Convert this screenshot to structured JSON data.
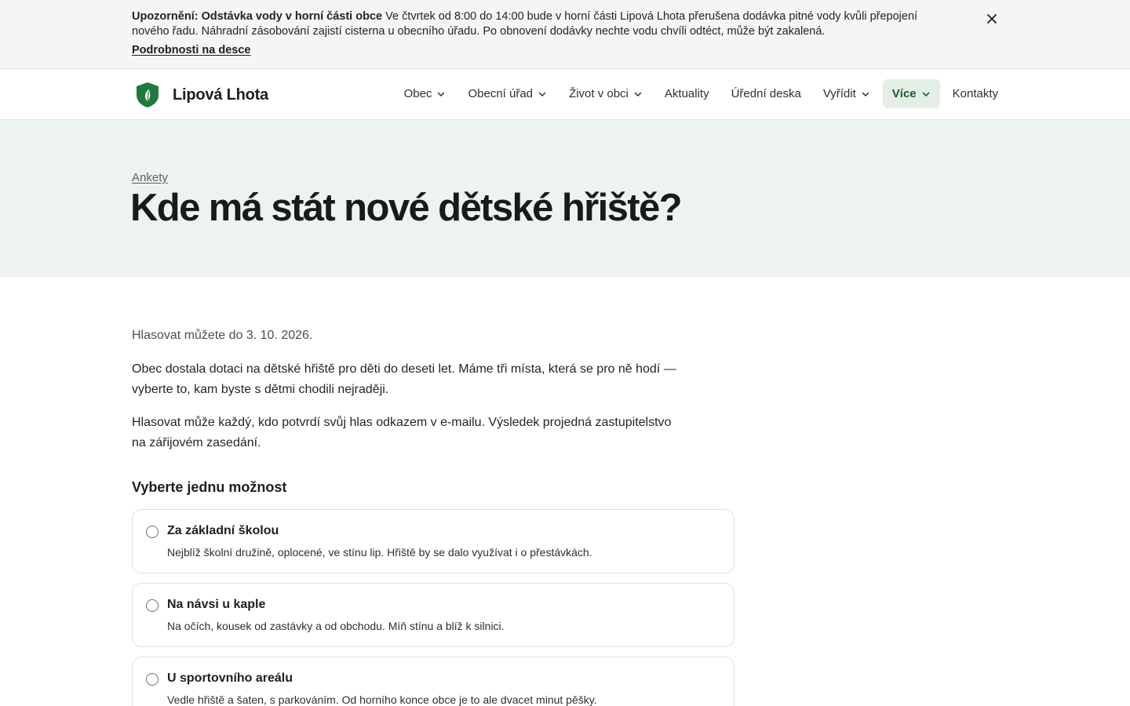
{
  "alert": {
    "title": "Upozornění: Odstávka vody v horní části obce",
    "text": " Ve čtvrtek od 8:00 do 14:00 bude v horní části Lipová Lhota přerušena dodávka pitné vody kvůli přepojení nového řadu. Náhradní zásobování zajistí cisterna u obecního úřadu. Po obnovení dodávky nechte vodu chvíli odtéct, může být zakalená.",
    "link": "Podrobnosti na desce",
    "close_icon": "close-icon"
  },
  "header": {
    "brand": "Lipová Lhota",
    "logo_icon": "shield-leaf-icon",
    "nav": [
      {
        "label": "Obec",
        "dropdown": true
      },
      {
        "label": "Obecní úřad",
        "dropdown": true
      },
      {
        "label": "Život v obci",
        "dropdown": true
      },
      {
        "label": "Aktuality",
        "dropdown": false
      },
      {
        "label": "Úřední deska",
        "dropdown": false
      },
      {
        "label": "Vyřídit",
        "dropdown": true
      },
      {
        "label": "Více",
        "dropdown": true,
        "active": true
      },
      {
        "label": "Kontakty",
        "dropdown": false
      }
    ]
  },
  "hero": {
    "breadcrumb": "Ankety",
    "title": "Kde má stát nové dětské hřiště?"
  },
  "main": {
    "deadline": "Hlasovat můžete do 3. 10. 2026.",
    "paragraphs": [
      "Obec dostala dotaci na dětské hřiště pro děti do deseti let. Máme tři místa, která se pro ně hodí — vyberte to, kam byste s dětmi chodili nejraději.",
      "Hlasovat může každý, kdo potvrdí svůj hlas odkazem v e-mailu. Výsledek projedná zastupitelstvo na zářijovém zasedání."
    ],
    "section_title": "Vyberte jednu možnost",
    "options": [
      {
        "title": "Za základní školou",
        "desc": "Nejblíž školní družině, oplocené, ve stínu lip. Hřiště by se dalo využívat i o přestávkách.",
        "selected": false
      },
      {
        "title": "Na návsi u kaple",
        "desc": "Na očích, kousek od zastávky a od obchodu. Míň stínu a blíž k silnici.",
        "selected": false
      },
      {
        "title": "U sportovního areálu",
        "desc": "Vedle hřiště a šaten, s parkováním. Od horního konce obce je to ale dvacet minut pěšky.",
        "selected": false
      }
    ]
  },
  "colors": {
    "accent": "#1f7a3e",
    "hero_bg": "#edf3ee",
    "active_nav_bg": "#e3efe5"
  }
}
